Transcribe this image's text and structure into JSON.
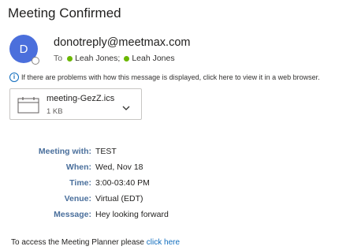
{
  "subject": "Meeting Confirmed",
  "sender": {
    "initial": "D",
    "email": "donotreply@meetmax.com",
    "avatar_color": "#4b6fdc"
  },
  "to": {
    "label": "To",
    "recipients": [
      "Leah Jones",
      "Leah Jones"
    ],
    "separator": ";"
  },
  "infobar": {
    "text": "If there are problems with how this message is displayed, click here to view it in a web browser."
  },
  "attachment": {
    "name": "meeting-GezZ.ics",
    "size": "1 KB"
  },
  "details": [
    {
      "label": "Meeting with:",
      "value": "TEST"
    },
    {
      "label": "When:",
      "value": "Wed, Nov 18"
    },
    {
      "label": "Time:",
      "value": "3:00-03:40 PM"
    },
    {
      "label": "Venue:",
      "value": "Virtual (EDT)"
    },
    {
      "label": "Message:",
      "value": "Hey looking forward"
    }
  ],
  "footer": {
    "text": "To access the Meeting Planner please",
    "link": "click here"
  },
  "colors": {
    "label": "#4a6f9c",
    "link": "#0f6cbd",
    "presence": "#6bb700"
  }
}
